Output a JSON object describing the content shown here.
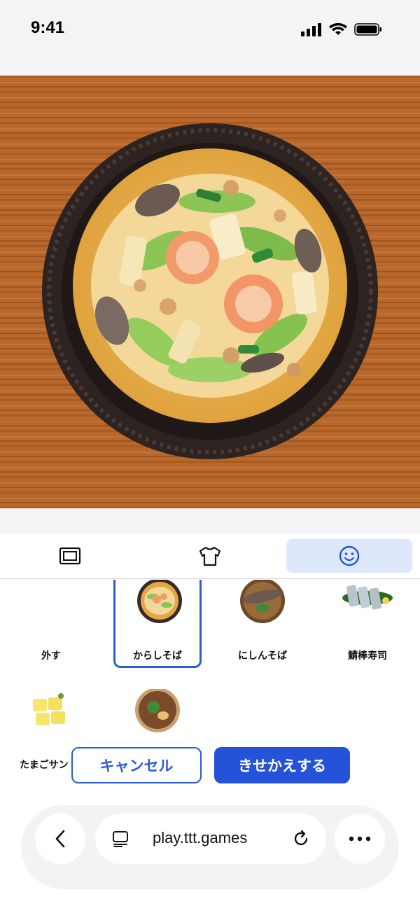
{
  "status_bar": {
    "time": "9:41"
  },
  "tabs": [
    {
      "name": "frame",
      "icon": "frame-icon",
      "active": false
    },
    {
      "name": "clothes",
      "icon": "shirt-icon",
      "active": false
    },
    {
      "name": "face",
      "icon": "smiley-icon",
      "active": true
    }
  ],
  "items": [
    {
      "label": "外す",
      "selected": false,
      "thumb": "none"
    },
    {
      "label": "からしそば",
      "selected": true,
      "thumb": "karashi-soba"
    },
    {
      "label": "にしんそば",
      "selected": false,
      "thumb": "nishin-soba"
    },
    {
      "label": "鯖棒寿司",
      "selected": false,
      "thumb": "saba-sushi"
    },
    {
      "label": "たまごサン",
      "selected": false,
      "thumb": "egg-sandwich"
    },
    {
      "label": "",
      "selected": false,
      "thumb": "ramen"
    }
  ],
  "buttons": {
    "cancel": "キャンセル",
    "confirm": "きせかえする"
  },
  "browser": {
    "url": "play.ttt.games"
  },
  "colors": {
    "accent": "#2452d8",
    "active_tab": "#dde9fb"
  }
}
